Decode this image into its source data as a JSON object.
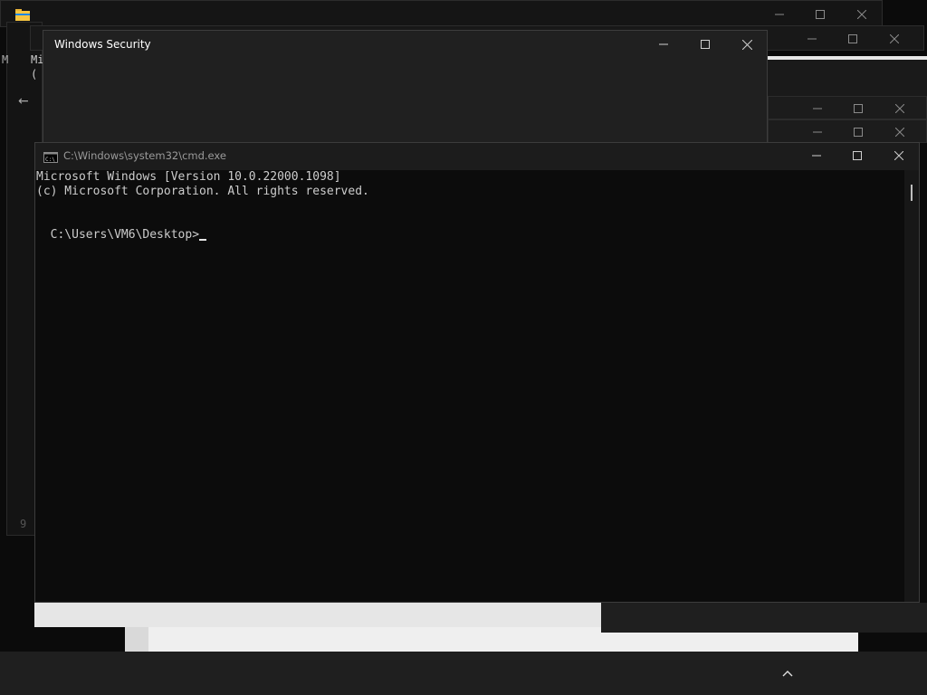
{
  "windows_security": {
    "title": "Windows Security"
  },
  "cmd": {
    "title": "C:\\Windows\\system32\\cmd.exe",
    "lines": [
      "Microsoft Windows [Version 10.0.22000.1098]",
      "(c) Microsoft Corporation. All rights reserved.",
      "",
      "C:\\Users\\VM6\\Desktop>"
    ]
  },
  "background_fragments": {
    "text_m": "Mi",
    "text_paren": "(",
    "text_n": "M",
    "text_9": "9"
  },
  "icons": {
    "file_explorer": "folder-icon",
    "cmd": "cmd-icon",
    "minimize": "minimize-icon",
    "maximize": "maximize-icon",
    "close": "close-icon",
    "back": "back-arrow-icon",
    "tray": "chevron-up-icon"
  },
  "colors": {
    "window_bg": "#1f1f1f",
    "terminal_bg": "#0c0c0c",
    "terminal_text": "#cccccc",
    "taskbar": "#1f1f1f"
  }
}
